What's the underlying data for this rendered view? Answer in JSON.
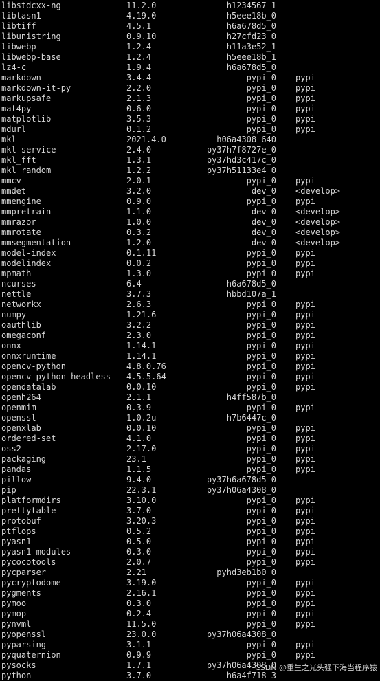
{
  "rows": [
    [
      "libstdcxx-ng",
      "11.2.0",
      "h1234567_1",
      ""
    ],
    [
      "libtasn1",
      "4.19.0",
      "h5eee18b_0",
      ""
    ],
    [
      "libtiff",
      "4.5.1",
      "h6a678d5_0",
      ""
    ],
    [
      "libunistring",
      "0.9.10",
      "h27cfd23_0",
      ""
    ],
    [
      "libwebp",
      "1.2.4",
      "h11a3e52_1",
      ""
    ],
    [
      "libwebp-base",
      "1.2.4",
      "h5eee18b_1",
      ""
    ],
    [
      "lz4-c",
      "1.9.4",
      "h6a678d5_0",
      ""
    ],
    [
      "markdown",
      "3.4.4",
      "pypi_0",
      "pypi"
    ],
    [
      "markdown-it-py",
      "2.2.0",
      "pypi_0",
      "pypi"
    ],
    [
      "markupsafe",
      "2.1.3",
      "pypi_0",
      "pypi"
    ],
    [
      "mat4py",
      "0.6.0",
      "pypi_0",
      "pypi"
    ],
    [
      "matplotlib",
      "3.5.3",
      "pypi_0",
      "pypi"
    ],
    [
      "mdurl",
      "0.1.2",
      "pypi_0",
      "pypi"
    ],
    [
      "mkl",
      "2021.4.0",
      "h06a4308_640",
      ""
    ],
    [
      "mkl-service",
      "2.4.0",
      "py37h7f8727e_0",
      ""
    ],
    [
      "mkl_fft",
      "1.3.1",
      "py37hd3c417c_0",
      ""
    ],
    [
      "mkl_random",
      "1.2.2",
      "py37h51133e4_0",
      ""
    ],
    [
      "mmcv",
      "2.0.1",
      "pypi_0",
      "pypi"
    ],
    [
      "mmdet",
      "3.2.0",
      "dev_0",
      "<develop>"
    ],
    [
      "mmengine",
      "0.9.0",
      "pypi_0",
      "pypi"
    ],
    [
      "mmpretrain",
      "1.1.0",
      "dev_0",
      "<develop>"
    ],
    [
      "mmrazor",
      "1.0.0",
      "dev_0",
      "<develop>"
    ],
    [
      "mmrotate",
      "0.3.2",
      "dev_0",
      "<develop>"
    ],
    [
      "mmsegmentation",
      "1.2.0",
      "dev_0",
      "<develop>"
    ],
    [
      "model-index",
      "0.1.11",
      "pypi_0",
      "pypi"
    ],
    [
      "modelindex",
      "0.0.2",
      "pypi_0",
      "pypi"
    ],
    [
      "mpmath",
      "1.3.0",
      "pypi_0",
      "pypi"
    ],
    [
      "ncurses",
      "6.4",
      "h6a678d5_0",
      ""
    ],
    [
      "nettle",
      "3.7.3",
      "hbbd107a_1",
      ""
    ],
    [
      "networkx",
      "2.6.3",
      "pypi_0",
      "pypi"
    ],
    [
      "numpy",
      "1.21.6",
      "pypi_0",
      "pypi"
    ],
    [
      "oauthlib",
      "3.2.2",
      "pypi_0",
      "pypi"
    ],
    [
      "omegaconf",
      "2.3.0",
      "pypi_0",
      "pypi"
    ],
    [
      "onnx",
      "1.14.1",
      "pypi_0",
      "pypi"
    ],
    [
      "onnxruntime",
      "1.14.1",
      "pypi_0",
      "pypi"
    ],
    [
      "opencv-python",
      "4.8.0.76",
      "pypi_0",
      "pypi"
    ],
    [
      "opencv-python-headless",
      "4.5.5.64",
      "pypi_0",
      "pypi"
    ],
    [
      "opendatalab",
      "0.0.10",
      "pypi_0",
      "pypi"
    ],
    [
      "openh264",
      "2.1.1",
      "h4ff587b_0",
      ""
    ],
    [
      "openmim",
      "0.3.9",
      "pypi_0",
      "pypi"
    ],
    [
      "openssl",
      "1.0.2u",
      "h7b6447c_0",
      ""
    ],
    [
      "openxlab",
      "0.0.10",
      "pypi_0",
      "pypi"
    ],
    [
      "ordered-set",
      "4.1.0",
      "pypi_0",
      "pypi"
    ],
    [
      "oss2",
      "2.17.0",
      "pypi_0",
      "pypi"
    ],
    [
      "packaging",
      "23.1",
      "pypi_0",
      "pypi"
    ],
    [
      "pandas",
      "1.1.5",
      "pypi_0",
      "pypi"
    ],
    [
      "pillow",
      "9.4.0",
      "py37h6a678d5_0",
      ""
    ],
    [
      "pip",
      "22.3.1",
      "py37h06a4308_0",
      ""
    ],
    [
      "platformdirs",
      "3.10.0",
      "pypi_0",
      "pypi"
    ],
    [
      "prettytable",
      "3.7.0",
      "pypi_0",
      "pypi"
    ],
    [
      "protobuf",
      "3.20.3",
      "pypi_0",
      "pypi"
    ],
    [
      "ptflops",
      "0.5.2",
      "pypi_0",
      "pypi"
    ],
    [
      "pyasn1",
      "0.5.0",
      "pypi_0",
      "pypi"
    ],
    [
      "pyasn1-modules",
      "0.3.0",
      "pypi_0",
      "pypi"
    ],
    [
      "pycocotools",
      "2.0.7",
      "pypi_0",
      "pypi"
    ],
    [
      "pycparser",
      "2.21",
      "pyhd3eb1b0_0",
      ""
    ],
    [
      "pycryptodome",
      "3.19.0",
      "pypi_0",
      "pypi"
    ],
    [
      "pygments",
      "2.16.1",
      "pypi_0",
      "pypi"
    ],
    [
      "pymoo",
      "0.3.0",
      "pypi_0",
      "pypi"
    ],
    [
      "pymop",
      "0.2.4",
      "pypi_0",
      "pypi"
    ],
    [
      "pynvml",
      "11.5.0",
      "pypi_0",
      "pypi"
    ],
    [
      "pyopenssl",
      "23.0.0",
      "py37h06a4308_0",
      ""
    ],
    [
      "pyparsing",
      "3.1.1",
      "pypi_0",
      "pypi"
    ],
    [
      "pyquaternion",
      "0.9.9",
      "pypi_0",
      "pypi"
    ],
    [
      "pysocks",
      "1.7.1",
      "py37h06a4308_0",
      ""
    ],
    [
      "python",
      "3.7.0",
      "h6a4f718_3",
      ""
    ]
  ],
  "watermark": "CSDN @重生之光头强下海当程序猿"
}
